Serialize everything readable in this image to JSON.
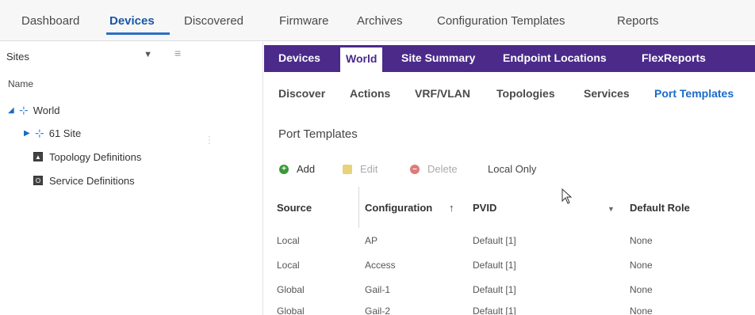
{
  "topnav": {
    "items": [
      "Dashboard",
      "Devices",
      "Discovered",
      "Firmware",
      "Archives",
      "Configuration Templates",
      "Reports"
    ],
    "active": "Devices"
  },
  "sidebar": {
    "select_value": "Sites",
    "tree_header": "Name",
    "tree": [
      {
        "label": "World"
      },
      {
        "label": "61 Site"
      },
      {
        "label": "Topology Definitions"
      },
      {
        "label": "Service Definitions"
      }
    ]
  },
  "tabs": {
    "items": [
      "Devices",
      "World",
      "Site Summary",
      "Endpoint Locations",
      "FlexReports"
    ],
    "active": "World"
  },
  "subtabs": {
    "items": [
      "Discover",
      "Actions",
      "VRF/VLAN",
      "Topologies",
      "Services",
      "Port Templates"
    ],
    "active": "Port Templates"
  },
  "section_title": "Port Templates",
  "toolbar": {
    "add": "Add",
    "edit": "Edit",
    "delete": "Delete",
    "local_only": "Local Only"
  },
  "table": {
    "headers": {
      "source": "Source",
      "configuration": "Configuration",
      "sort_indicator": "↑",
      "pvid": "PVID",
      "default_role": "Default Role"
    },
    "rows": [
      {
        "source": "Local",
        "configuration": "AP",
        "pvid": "Default [1]",
        "role": "None"
      },
      {
        "source": "Local",
        "configuration": "Access",
        "pvid": "Default [1]",
        "role": "None"
      },
      {
        "source": "Global",
        "configuration": "Gail-1",
        "pvid": "Default [1]",
        "role": "None"
      },
      {
        "source": "Global",
        "configuration": "Gail-2",
        "pvid": "Default [1]",
        "role": "None"
      }
    ]
  },
  "colors": {
    "tab_bar": "#4b2a8a",
    "accent_blue": "#1a6ac8",
    "add_green": "#3a9a3a",
    "delete_red": "#e07a7a"
  }
}
